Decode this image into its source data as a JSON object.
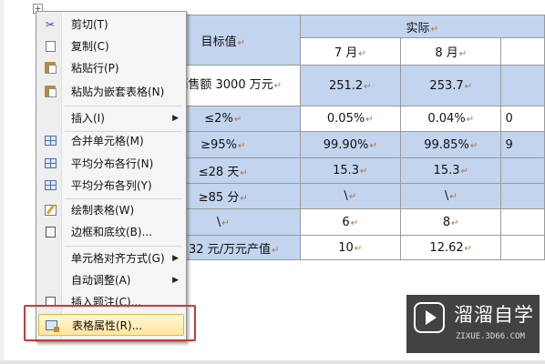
{
  "table": {
    "header": {
      "target": "目标值",
      "actual": "实际",
      "july": "7 月",
      "aug": "8 月"
    },
    "rows": [
      {
        "target": "年销售额 3000 万元",
        "jul": "251.2",
        "aug": "253.7"
      },
      {
        "target": "≤2%",
        "jul": "0.05%",
        "aug": "0.04%",
        "next": "0"
      },
      {
        "target": "≥95%",
        "jul": "99.90%",
        "aug": "99.85%",
        "next": "9"
      },
      {
        "target": "≤28 天",
        "jul": "15.3",
        "aug": "15.3"
      },
      {
        "target": "≥85 分",
        "jul": "\\",
        "aug": "\\"
      },
      {
        "target": "\\",
        "jul": "6",
        "aug": "8"
      },
      {
        "target": "32 元/万元产值",
        "jul": "10",
        "aug": "12.62"
      }
    ],
    "paragraph_mark": "↵"
  },
  "context_menu": {
    "items": [
      {
        "label": "剪切(T)",
        "icon": "scissors-icon"
      },
      {
        "label": "复制(C)",
        "icon": "copy-icon"
      },
      {
        "label": "粘贴行(P)",
        "icon": "paste-icon"
      },
      {
        "label": "粘贴为嵌套表格(N)",
        "icon": "paste-nested-icon"
      },
      {
        "label": "插入(I)",
        "submenu": true
      },
      {
        "label": "合并单元格(M)",
        "icon": "merge-cells-icon"
      },
      {
        "label": "平均分布各行(N)",
        "icon": "distribute-rows-icon"
      },
      {
        "label": "平均分布各列(Y)",
        "icon": "distribute-columns-icon"
      },
      {
        "label": "绘制表格(W)",
        "icon": "draw-table-icon"
      },
      {
        "label": "边框和底纹(B)...",
        "icon": "borders-icon"
      },
      {
        "label": "单元格对齐方式(G)",
        "submenu": true
      },
      {
        "label": "自动调整(A)",
        "submenu": true
      },
      {
        "label": "插入题注(C)...",
        "icon": "caption-icon"
      },
      {
        "label": "表格属性(R)...",
        "icon": "table-properties-icon",
        "highlighted": true
      }
    ],
    "submenu_arrow": "▶"
  },
  "watermark": {
    "title": "溜溜自学",
    "url": "ZIXUE.3D66.COM"
  },
  "colors": {
    "selection": "#c2d4ee",
    "highlight": "#ffe59a",
    "annotation_box": "#c8383a"
  }
}
